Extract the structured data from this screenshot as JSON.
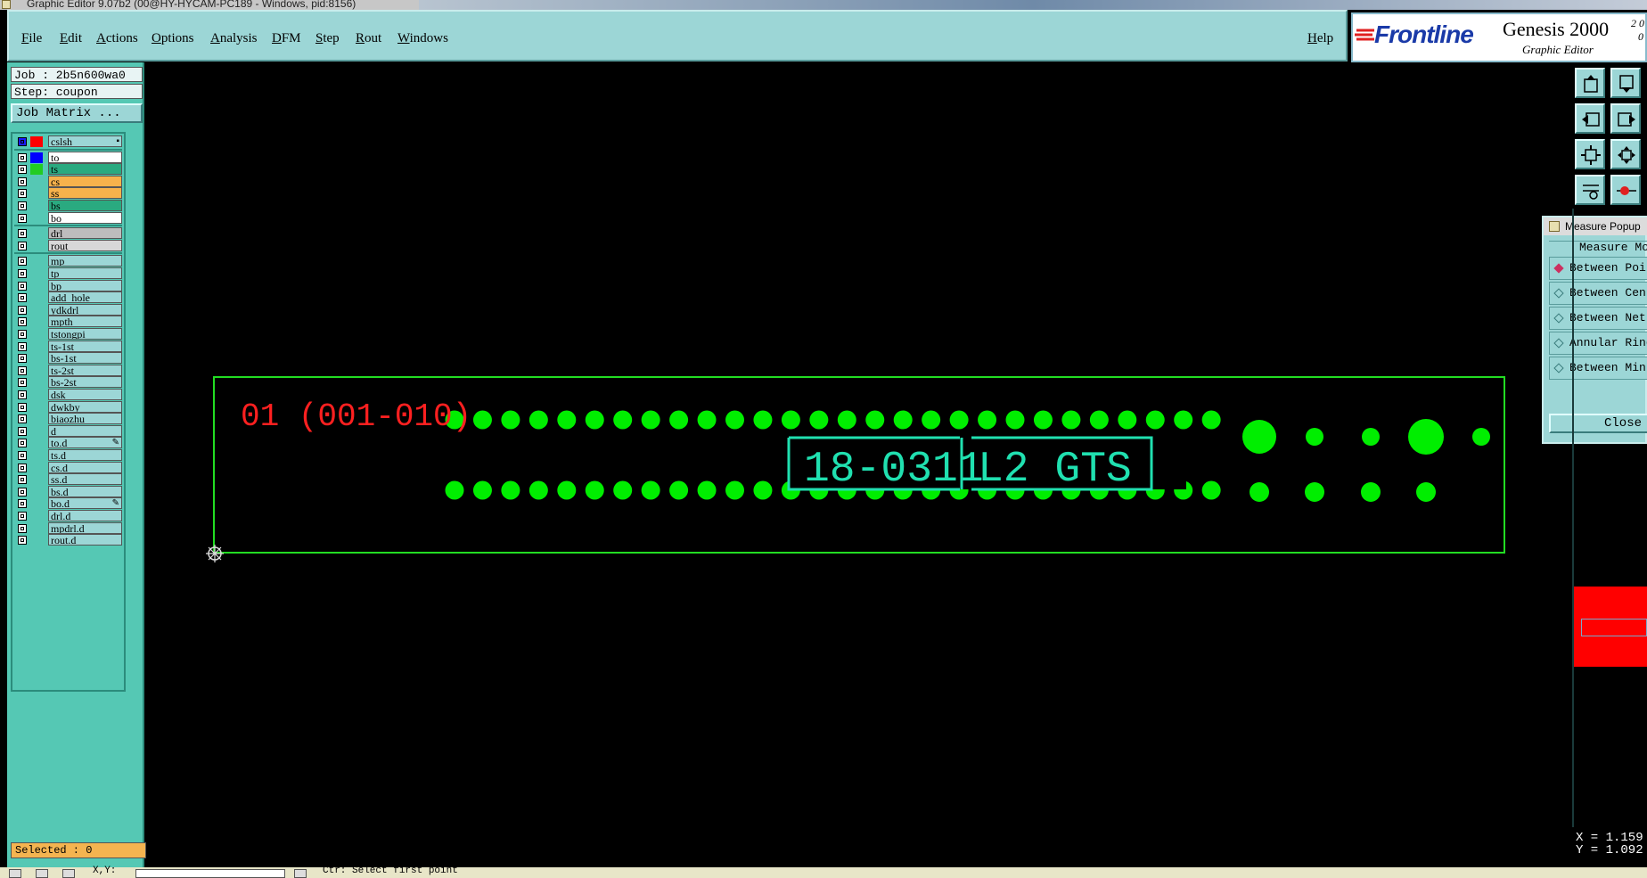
{
  "window": {
    "title": "Graphic Editor 9.07b2 (00@HY-HYCAM-PC189 - Windows, pid:8156)"
  },
  "menu": {
    "items": [
      "File",
      "Edit",
      "Actions",
      "Options",
      "Analysis",
      "DFM",
      "Step",
      "Rout",
      "Windows"
    ],
    "help": "Help"
  },
  "logo": {
    "brand": "Frontline",
    "product": "Genesis 2000",
    "subtitle": "Graphic Editor",
    "version_top": "2 0",
    "version_bot": "0"
  },
  "job": {
    "job_label": "Job : 2b5n600wa0",
    "step_label": "Step: coupon",
    "matrix_button": "Job Matrix ..."
  },
  "layers": {
    "top": [
      {
        "name": "cslsh",
        "swatch": "#ff0000",
        "name_bg": "#9cd6d6"
      }
    ],
    "board": [
      {
        "name": "to",
        "swatch": "#0000ff",
        "name_bg": "#ffffff"
      },
      {
        "name": "ts",
        "swatch": "#22cc22",
        "name_bg": "#2aaa80"
      },
      {
        "name": "cs",
        "swatch": "",
        "name_bg": "#f6b24c"
      },
      {
        "name": "ss",
        "swatch": "",
        "name_bg": "#f6b24c"
      },
      {
        "name": "bs",
        "swatch": "",
        "name_bg": "#2aaa80"
      },
      {
        "name": "bo",
        "swatch": "",
        "name_bg": "#ffffff"
      }
    ],
    "drill": [
      {
        "name": "drl",
        "swatch": "",
        "name_bg": "#bdbdbd"
      },
      {
        "name": "rout",
        "swatch": "",
        "name_bg": "#d8d8d8"
      }
    ],
    "misc": [
      {
        "name": "mp",
        "mark": ""
      },
      {
        "name": "tp",
        "mark": ""
      },
      {
        "name": "bp",
        "mark": ""
      },
      {
        "name": "add_hole",
        "mark": ""
      },
      {
        "name": "ydkdrl",
        "mark": ""
      },
      {
        "name": "mpth",
        "mark": ""
      },
      {
        "name": "tstongpi",
        "mark": ""
      },
      {
        "name": "ts-1st",
        "mark": ""
      },
      {
        "name": "bs-1st",
        "mark": ""
      },
      {
        "name": "ts-2st",
        "mark": ""
      },
      {
        "name": "bs-2st",
        "mark": ""
      },
      {
        "name": "dsk",
        "mark": ""
      },
      {
        "name": "dwkby",
        "mark": ""
      },
      {
        "name": "biaozhu",
        "mark": ""
      },
      {
        "name": "d",
        "mark": ""
      },
      {
        "name": "to.d",
        "mark": "✎"
      },
      {
        "name": "ts.d",
        "mark": ""
      },
      {
        "name": "cs.d",
        "mark": ""
      },
      {
        "name": "ss.d",
        "mark": ""
      },
      {
        "name": "bs.d",
        "mark": ""
      },
      {
        "name": "bo.d",
        "mark": "✎"
      },
      {
        "name": "drl.d",
        "mark": ""
      },
      {
        "name": "mpdrl.d",
        "mark": ""
      },
      {
        "name": "rout.d",
        "mark": ""
      }
    ]
  },
  "selected": "Selected : 0",
  "canvas": {
    "step_text": "01 (001-010)",
    "coupon_text_left": "18-0311",
    "coupon_text_right": "L2 GTS",
    "pad_rows": 2,
    "pads_per_row": 28
  },
  "measure_popup": {
    "title": "Measure Popup",
    "section": "Measure Mode",
    "options": [
      "Between Points",
      "Between Centers",
      "Between Nets",
      "Annular Ring",
      "Between Min"
    ],
    "close_label": "Close"
  },
  "readout": {
    "x": "X = 1.159",
    "y": "Y = 1.092"
  },
  "status": {
    "xy_label": "X,Y:",
    "prompt": "Ctr: Select first point"
  },
  "colors": {
    "panel": "#55c8b4",
    "menubar": "#9cd6d6",
    "outline": "#22dd22",
    "pads": "#00ee00",
    "text_red": "#ff2020",
    "text_cyan": "#20e0b0"
  }
}
